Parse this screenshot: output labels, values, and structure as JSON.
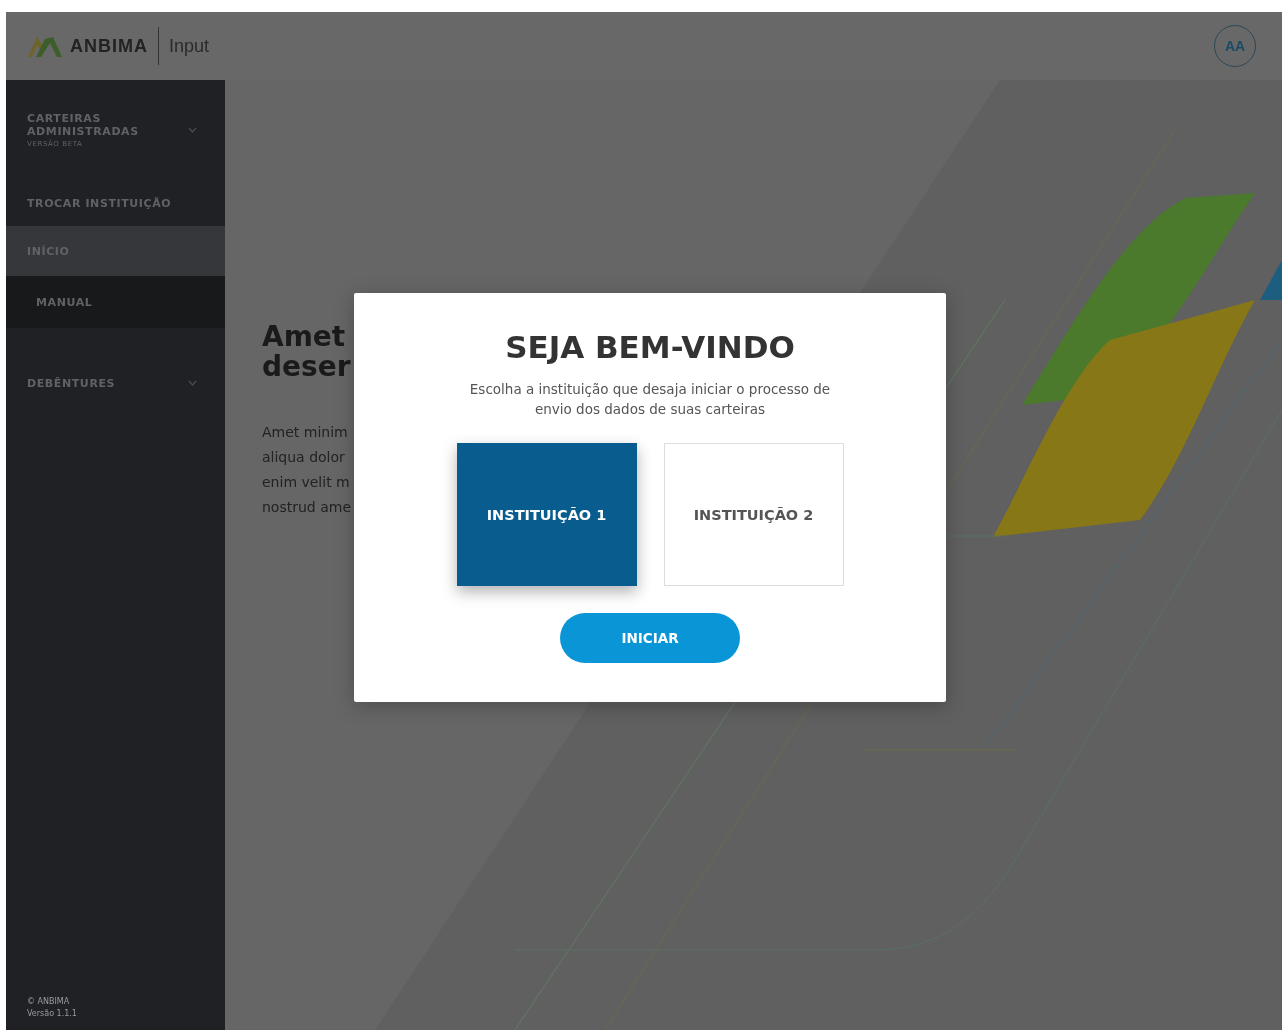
{
  "header": {
    "brand": "ANBIMA",
    "product": "Input",
    "avatar": "AA"
  },
  "sidebar": {
    "items": [
      {
        "kind": "group",
        "label": "CARTEIRAS ADMINISTRADAS",
        "note": "VERSÃO BETA",
        "selected": false
      },
      {
        "kind": "link",
        "label": "TROCAR INSTITUIÇÃO",
        "selected": false
      },
      {
        "kind": "link",
        "label": "INÍCIO",
        "selected": true
      },
      {
        "kind": "sub",
        "label": "MANUAL",
        "selected": false
      },
      {
        "kind": "group",
        "label": "DEBÊNTURES",
        "selected": false
      }
    ],
    "footer": [
      "© ANBIMA",
      "Versão 1.1.1"
    ]
  },
  "content": {
    "heading": [
      "Amet",
      "deser"
    ],
    "paragraph": [
      "Amet minim",
      "aliqua dolor",
      "enim velit m",
      "nostrud ame"
    ]
  },
  "dialog": {
    "title": "SEJA BEM-VINDO",
    "subtitle": "Escolha a instituição que desaja iniciar o processo de envio dos dados de suas carteiras",
    "options": [
      {
        "label": "INSTITUIÇÃO 1",
        "selected": true
      },
      {
        "label": "INSTITUIÇÃO 2",
        "selected": false
      }
    ],
    "button": "INICIAR"
  }
}
